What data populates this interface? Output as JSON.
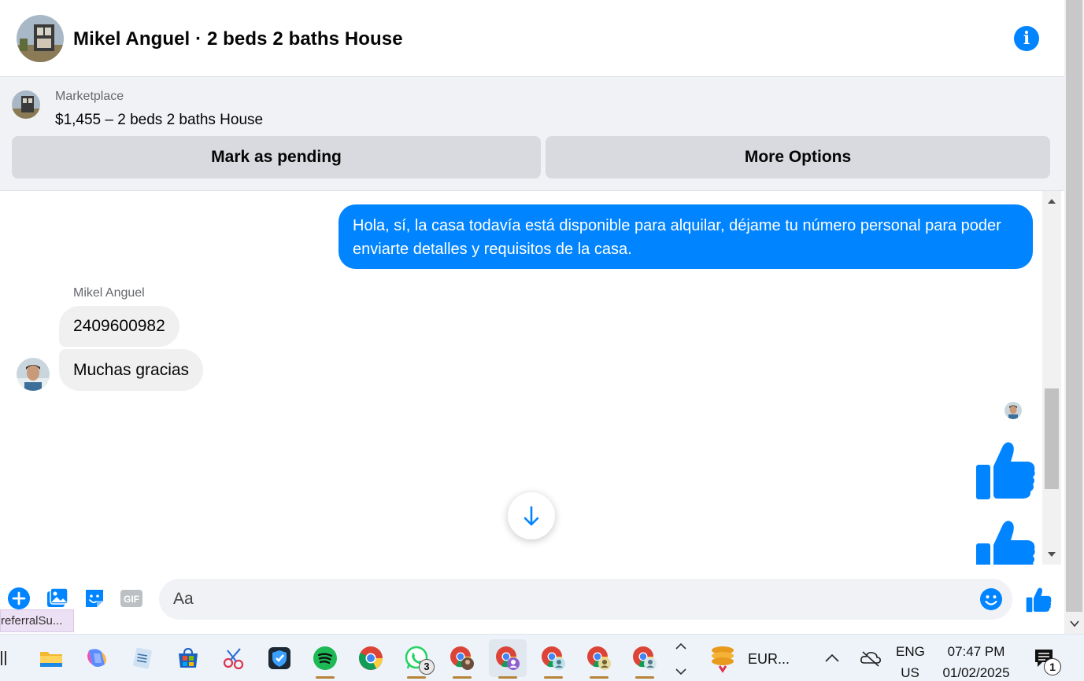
{
  "header": {
    "title": "Mikel Anguel · 2 beds 2 baths House",
    "info_icon": "info-icon"
  },
  "marketplace": {
    "label": "Marketplace",
    "listing": "$1,455 – 2 beds 2 baths House",
    "pending_button": "Mark as pending",
    "more_button": "More Options"
  },
  "messages": {
    "outgoing": "Hola, sí, la casa todavía está disponible para alquilar, déjame tu número personal para poder enviarte detalles y requisitos de la casa.",
    "sender_name": "Mikel Anguel",
    "incoming": [
      "2409600982",
      "Muchas gracias"
    ]
  },
  "composer": {
    "placeholder": "Aa",
    "tools": [
      "plus-icon",
      "photo-icon",
      "sticker-icon",
      "gif-icon"
    ],
    "tooltip": "referralSu..."
  },
  "taskbar": {
    "apps": [
      "file-explorer-icon",
      "copilot-icon",
      "notepad-icon",
      "store-icon",
      "snipping-icon",
      "vpn-icon",
      "spotify-icon",
      "chrome-icon",
      "whatsapp-icon",
      "chrome-profile-icon",
      "chrome-profile-icon",
      "chrome-profile-icon",
      "chrome-profile-icon",
      "chrome-profile-icon"
    ],
    "whatsapp_badge": "3",
    "widget_text": "EUR...",
    "lang_line1": "ENG",
    "lang_line2": "US",
    "time": "07:47 PM",
    "date": "01/02/2025",
    "notification_count": "1"
  },
  "colors": {
    "messenger_blue": "#0084ff",
    "bubble_gray": "#f0f0f0",
    "panel_gray": "#f0f2f5",
    "button_gray": "#d8dadf"
  }
}
